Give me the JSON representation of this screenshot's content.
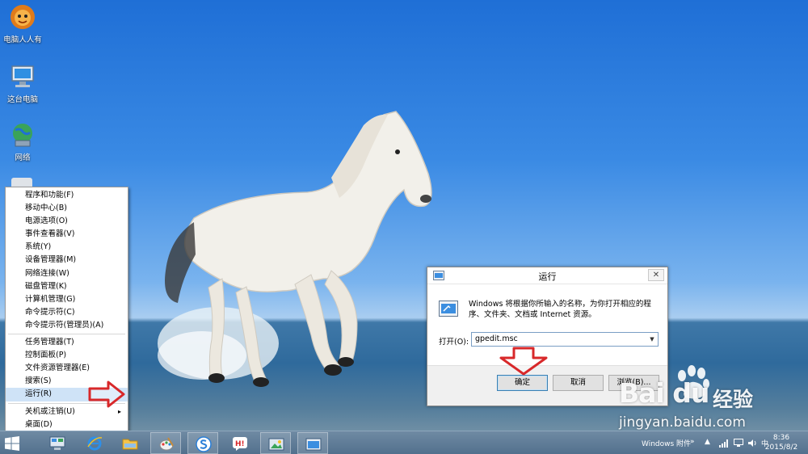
{
  "desktop": {
    "icons": [
      {
        "label": "电脑人人有",
        "icon": "lion-mascot-icon"
      },
      {
        "label": "这台电脑",
        "icon": "computer-icon"
      },
      {
        "label": "网络",
        "icon": "network-globe-icon"
      }
    ]
  },
  "winx_menu": {
    "group1": [
      "程序和功能(F)",
      "移动中心(B)",
      "电源选项(O)",
      "事件查看器(V)",
      "系统(Y)",
      "设备管理器(M)",
      "网络连接(W)",
      "磁盘管理(K)",
      "计算机管理(G)",
      "命令提示符(C)",
      "命令提示符(管理员)(A)"
    ],
    "group2": [
      "任务管理器(T)",
      "控制面板(P)",
      "文件资源管理器(E)",
      "搜索(S)",
      "运行(R)"
    ],
    "group3": [
      "关机或注销(U)",
      "桌面(D)"
    ],
    "highlighted": "运行(R)",
    "submenu_arrow": "▸"
  },
  "run_dialog": {
    "title": "运行",
    "close_glyph": "✕",
    "description": "Windows 将根据你所输入的名称，为你打开相应的程序、文件夹、文档或 Internet 资源。",
    "open_label": "打开(O):",
    "open_value": "gpedit.msc",
    "buttons": {
      "ok": "确定",
      "cancel": "取消",
      "browse": "浏览(B)..."
    }
  },
  "taskbar": {
    "toolbar_label": "Windows 附件",
    "tray_chevron": "»",
    "ime": "中",
    "time": "8:36",
    "date": "2015/8/2"
  },
  "watermark": {
    "brand": "Bai du",
    "brand_cn": "经验",
    "url": "jingyan.baidu.com"
  },
  "colors": {
    "accent_red": "#d8282a",
    "menu_highlight": "#cfe3f7",
    "taskbar": "#5a7893"
  }
}
